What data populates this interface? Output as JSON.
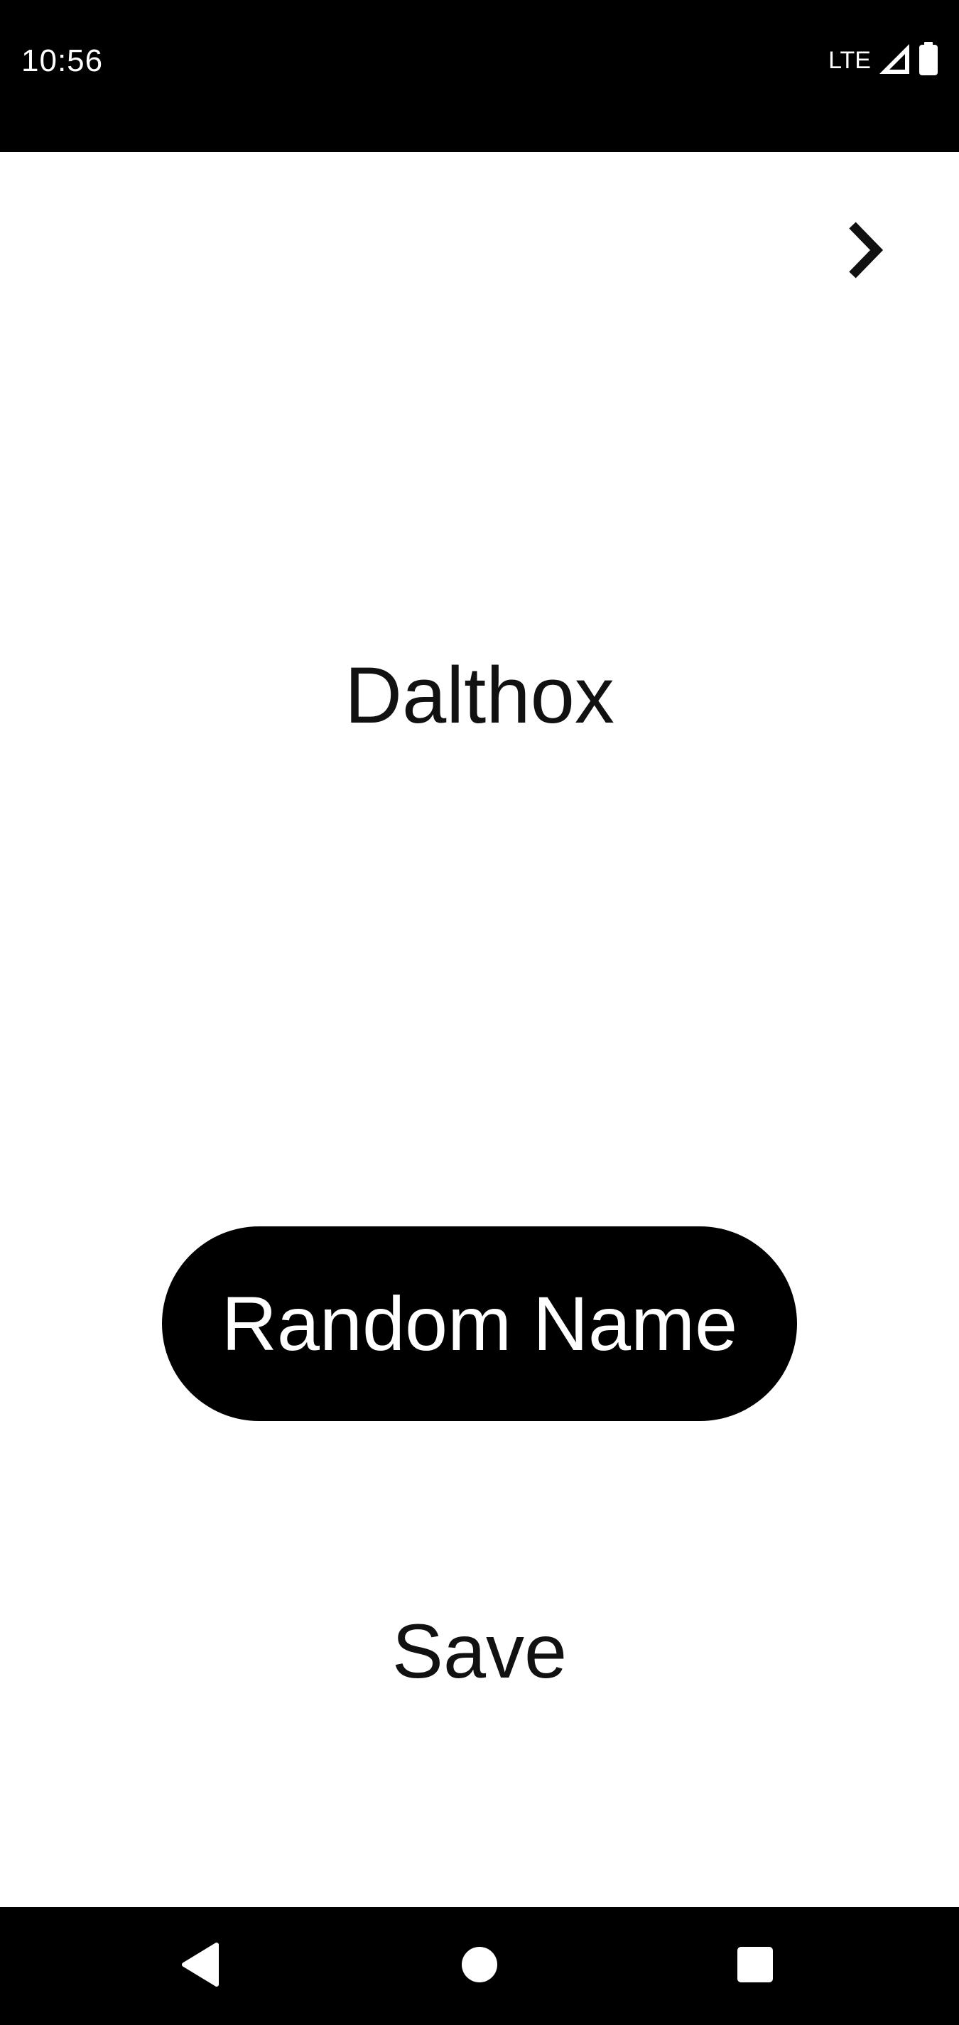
{
  "status_bar": {
    "time": "10:56",
    "network": "LTE"
  },
  "header": {
    "next_icon": "chevron-right-icon"
  },
  "main": {
    "generated_name": "Dalthox",
    "random_button_label": "Random Name",
    "save_button_label": "Save"
  },
  "nav_bar": {
    "back_icon": "back-triangle-icon",
    "home_icon": "home-circle-icon",
    "recents_icon": "recents-square-icon"
  },
  "colors": {
    "background": "#ffffff",
    "bars": "#000000",
    "button": "#000000",
    "button_text": "#ffffff",
    "text": "#111111"
  }
}
